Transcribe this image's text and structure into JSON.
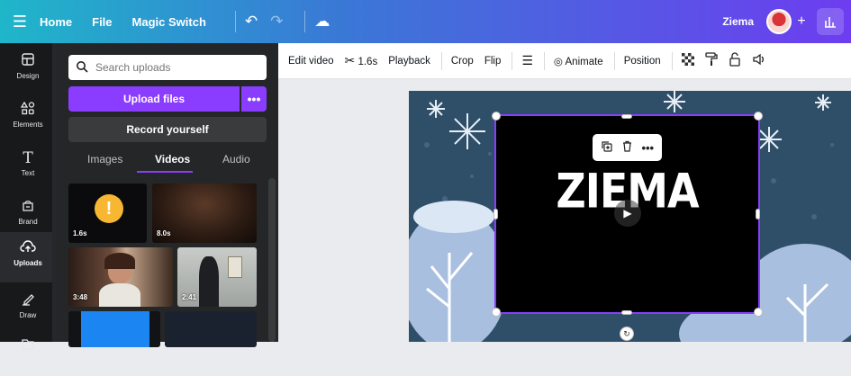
{
  "topbar": {
    "menu_icon": "hamburger-icon",
    "home": "Home",
    "file": "File",
    "magic_switch": "Magic Switch",
    "user_name": "Ziema",
    "plus": "+"
  },
  "rail": {
    "items": [
      {
        "label": "Design",
        "icon": "layout-icon"
      },
      {
        "label": "Elements",
        "icon": "shapes-icon"
      },
      {
        "label": "Text",
        "icon": "text-icon"
      },
      {
        "label": "Brand",
        "icon": "brand-icon"
      },
      {
        "label": "Uploads",
        "icon": "cloud-upload-icon"
      },
      {
        "label": "Draw",
        "icon": "pen-icon"
      }
    ]
  },
  "panel": {
    "search_placeholder": "Search uploads",
    "upload_label": "Upload files",
    "upload_more": "•••",
    "record_label": "Record yourself",
    "tabs": [
      "Images",
      "Videos",
      "Audio"
    ],
    "active_tab": "Videos",
    "thumbs": [
      {
        "duration": "1.6s"
      },
      {
        "duration": "8.0s"
      },
      {
        "duration": "3:48"
      },
      {
        "duration": "2:41"
      },
      {
        "duration": ""
      },
      {
        "duration": ""
      }
    ]
  },
  "context_toolbar": {
    "edit_video": "Edit video",
    "trim": "1.6s",
    "playback": "Playback",
    "crop": "Crop",
    "flip": "Flip",
    "animate": "Animate",
    "position": "Position"
  },
  "canvas": {
    "title_text": "ZIEMA",
    "page_color": "#2f4e68"
  },
  "colors": {
    "accent": "#8b3dff",
    "rail_bg": "#18191b",
    "panel_bg": "#252627"
  }
}
